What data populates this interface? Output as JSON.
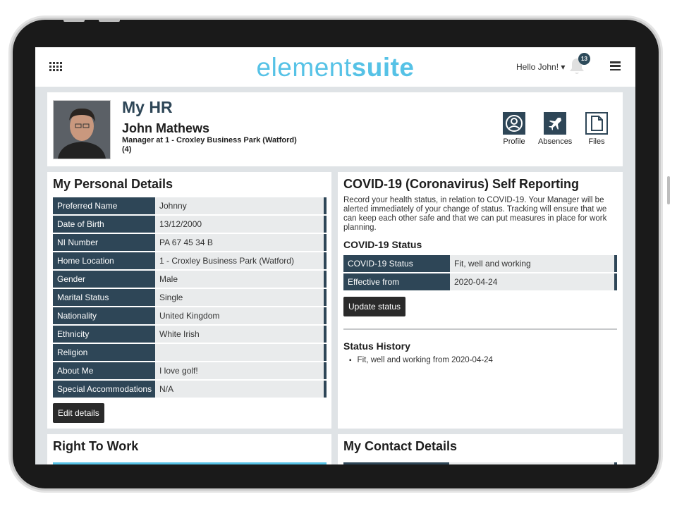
{
  "header": {
    "brand_part1": "element",
    "brand_part2": "suite",
    "greeting": "Hello John!",
    "notification_count": "13"
  },
  "my_hr": {
    "title": "My HR",
    "name": "John Mathews",
    "role": "Manager at 1 - Croxley Business Park (Watford) (4)",
    "links": [
      {
        "label": "Profile",
        "icon": "user-icon"
      },
      {
        "label": "Absences",
        "icon": "plane-icon"
      },
      {
        "label": "Files",
        "icon": "file-icon"
      }
    ]
  },
  "personal_details": {
    "title": "My Personal Details",
    "rows": [
      {
        "label": "Preferred Name",
        "value": "Johnny"
      },
      {
        "label": "Date of Birth",
        "value": "13/12/2000"
      },
      {
        "label": "NI Number",
        "value": "PA 67 45 34 B"
      },
      {
        "label": "Home Location",
        "value": "1 - Croxley Business Park (Watford)"
      },
      {
        "label": "Gender",
        "value": "Male"
      },
      {
        "label": "Marital Status",
        "value": "Single"
      },
      {
        "label": "Nationality",
        "value": "United Kingdom"
      },
      {
        "label": "Ethnicity",
        "value": "White Irish"
      },
      {
        "label": "Religion",
        "value": ""
      },
      {
        "label": "About Me",
        "value": "I love golf!"
      },
      {
        "label": "Special Accommodations",
        "value": "N/A"
      }
    ],
    "edit_button": "Edit details"
  },
  "covid": {
    "title": "COVID-19 (Coronavirus) Self Reporting",
    "description": "Record your health status, in relation to COVID-19. Your Manager will be alerted immediately of your change of status. Tracking will ensure that we can keep each other safe and that we can put measures in place for work planning.",
    "status_heading": "COVID-19 Status",
    "rows": [
      {
        "label": "COVID-19 Status",
        "value": "Fit, well and working"
      },
      {
        "label": "Effective from",
        "value": "2020-04-24"
      }
    ],
    "update_button": "Update status",
    "history_heading": "Status History",
    "history": [
      "Fit, well and working from 2020-04-24"
    ]
  },
  "right_to_work": {
    "title": "Right To Work"
  },
  "contact_details": {
    "title": "My Contact Details"
  },
  "colors": {
    "accent": "#56c2e6",
    "dark": "#2e4657"
  }
}
